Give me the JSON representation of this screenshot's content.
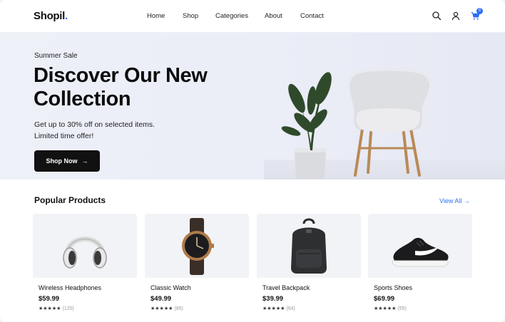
{
  "brand": {
    "name": "Shopil",
    "dot": "."
  },
  "nav": [
    "Home",
    "Shop",
    "Categories",
    "About",
    "Contact"
  ],
  "header_icons": [
    "search-icon",
    "user-icon",
    "cart-icon"
  ],
  "cart": {
    "count": "0"
  },
  "hero": {
    "eyebrow": "Summer Sale",
    "title": "Discover Our New Collection",
    "subtitle_line1": "Get up to 30% off on selected items.",
    "subtitle_line2": "Limited time offer!",
    "cta_label": "Shop Now",
    "cta_arrow": "→"
  },
  "products_section": {
    "title": "Popular Products",
    "view_all": "View All",
    "view_all_arrow": "→"
  },
  "products": [
    {
      "name": "Wireless Headphones",
      "price": "$59.99",
      "stars": "★★★★★",
      "reviews": "(120)",
      "icon": "headphones-icon"
    },
    {
      "name": "Classic Watch",
      "price": "$49.99",
      "stars": "★★★★★",
      "reviews": "(85)",
      "icon": "watch-icon"
    },
    {
      "name": "Travel Backpack",
      "price": "$39.99",
      "stars": "★★★★★",
      "reviews": "(64)",
      "icon": "backpack-icon"
    },
    {
      "name": "Sports Shoes",
      "price": "$69.99",
      "stars": "★★★★★",
      "reviews": "(55)",
      "icon": "shoe-icon"
    }
  ],
  "colors": {
    "accent": "#2b6ff5",
    "cta_bg": "#111111",
    "hero_bg": "#eef0f8",
    "card_bg": "#f2f3f6"
  }
}
